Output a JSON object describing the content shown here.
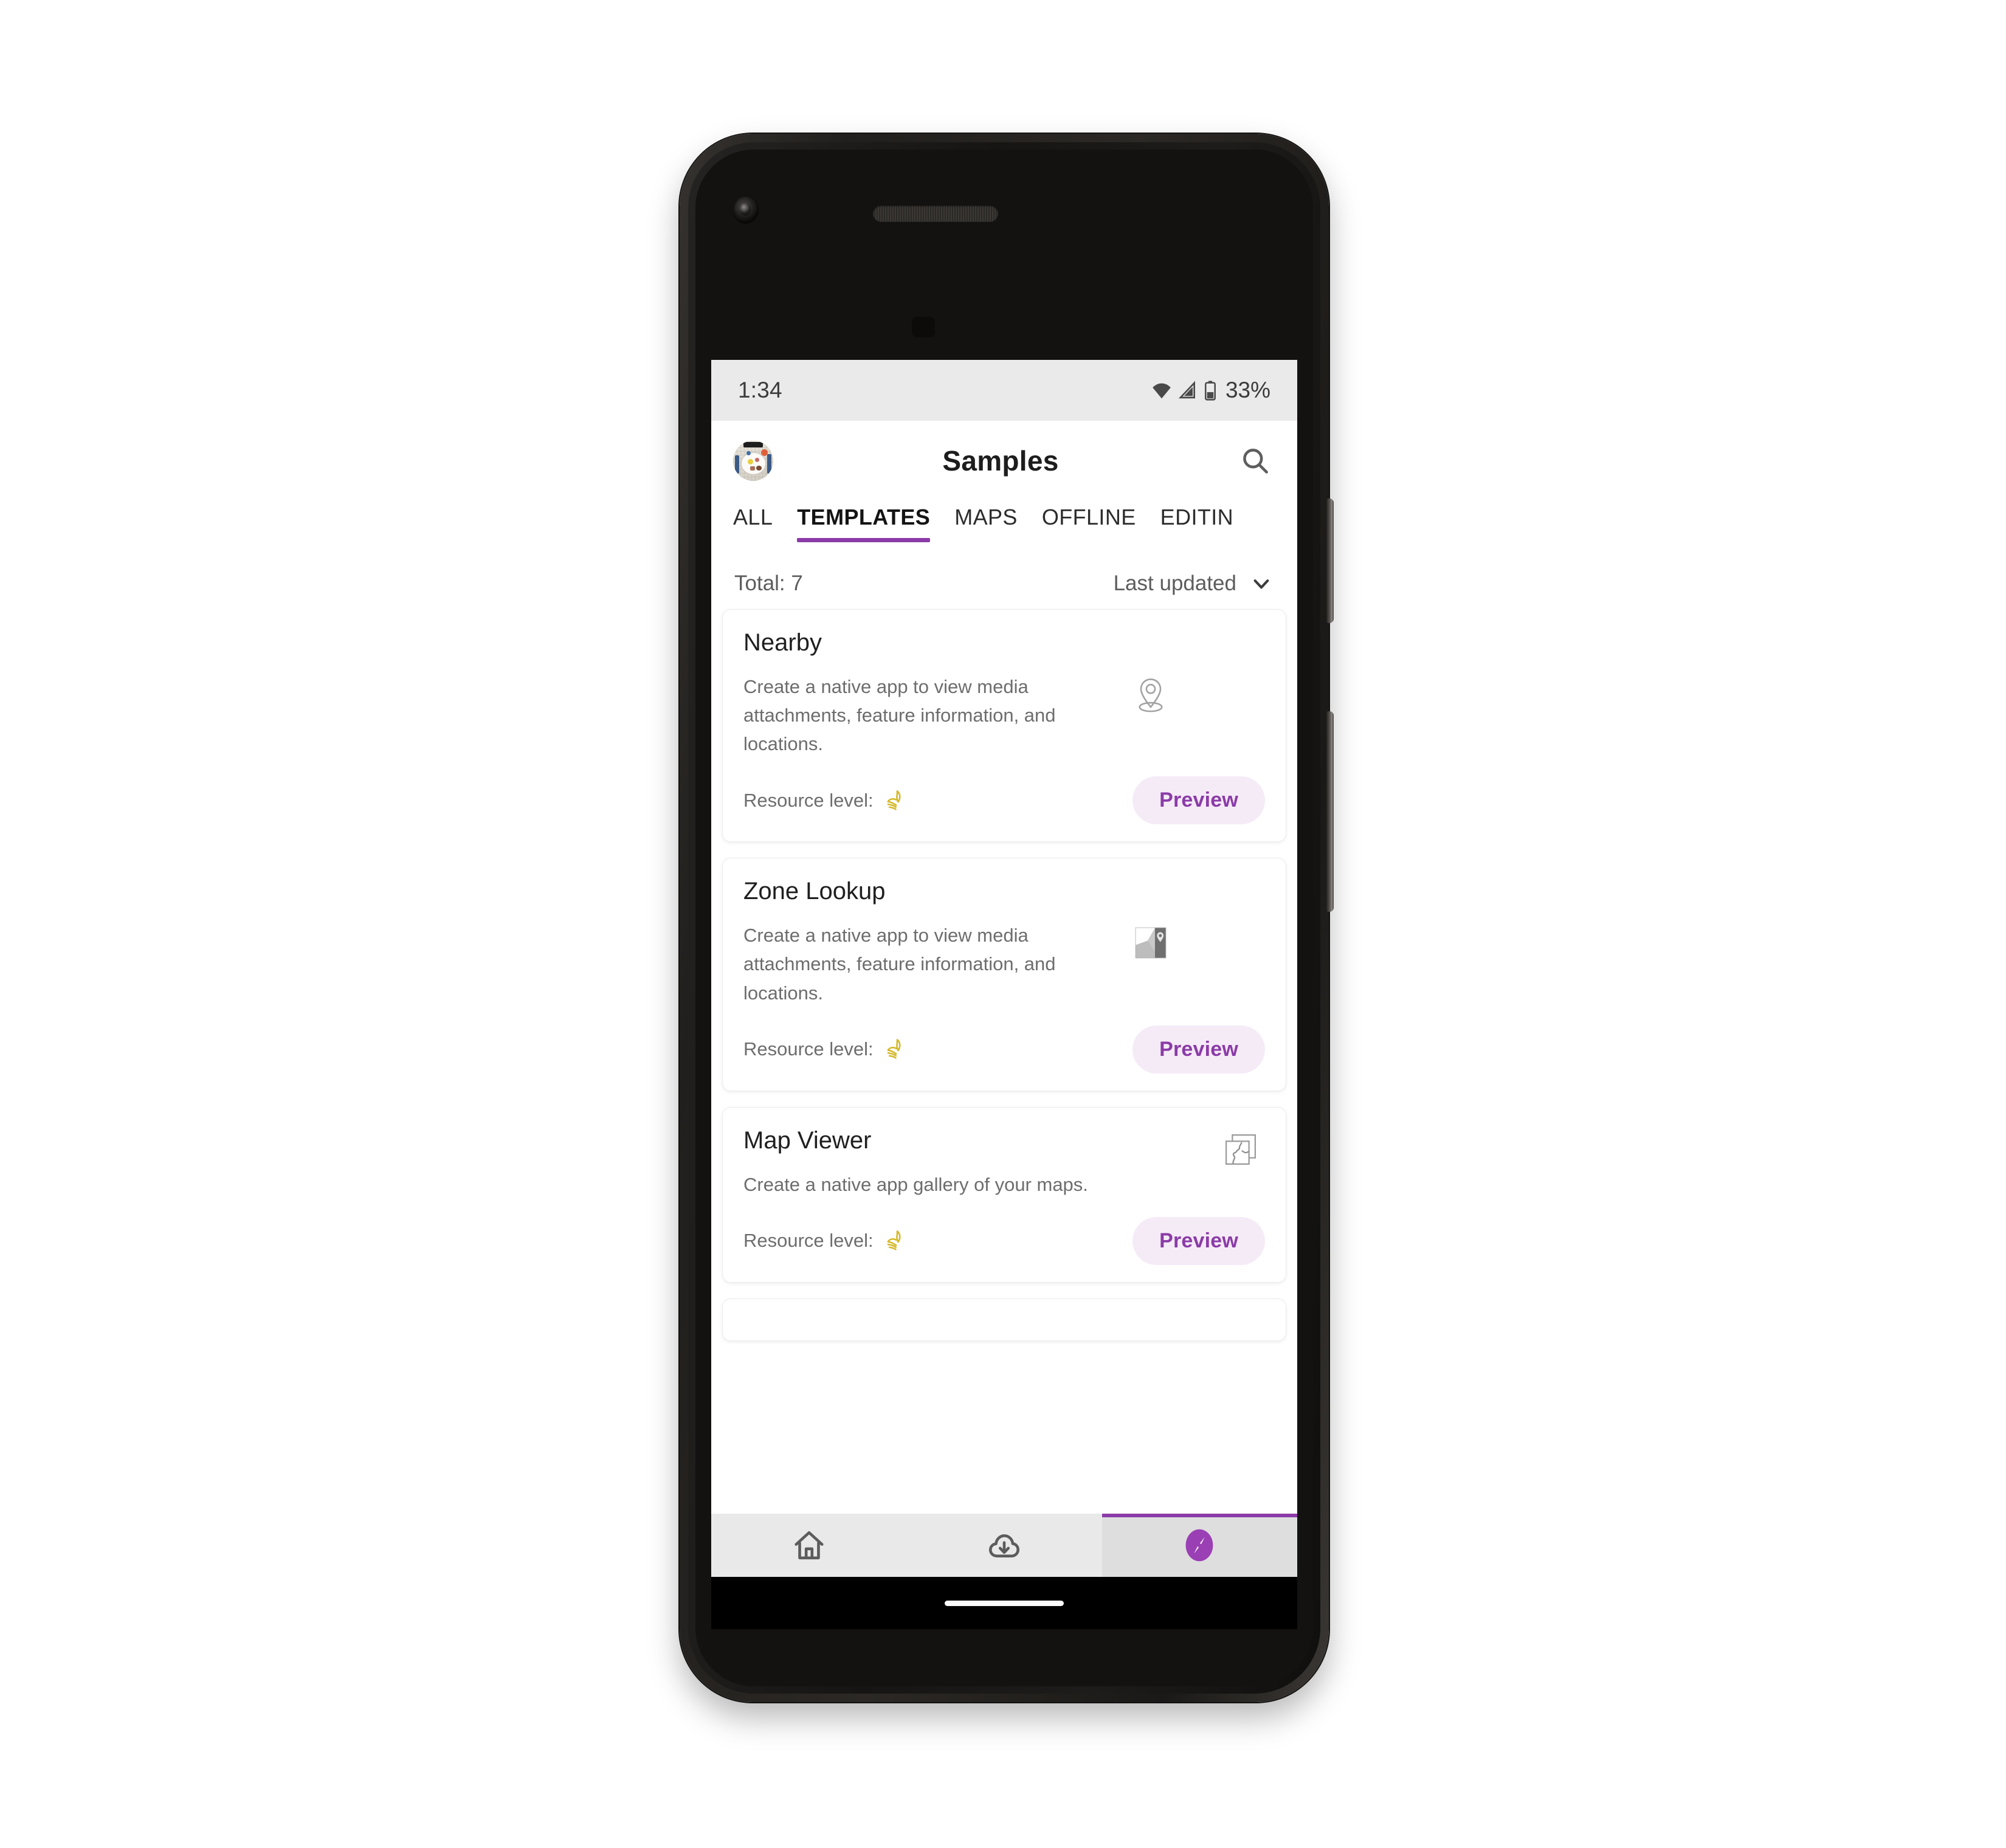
{
  "status_bar": {
    "time": "1:34",
    "battery_percent": "33%",
    "icons": [
      "wifi-icon",
      "cellular-signal-icon",
      "battery-icon"
    ]
  },
  "app_bar": {
    "title": "Samples",
    "avatar_name": "user-avatar",
    "search_icon": "search-icon"
  },
  "tabs": [
    {
      "label": "ALL",
      "active": false
    },
    {
      "label": "TEMPLATES",
      "active": true
    },
    {
      "label": "MAPS",
      "active": false
    },
    {
      "label": "OFFLINE",
      "active": false
    },
    {
      "label": "EDITIN",
      "active": false
    }
  ],
  "meta": {
    "total_label": "Total: 7",
    "sort_label": "Last updated",
    "sort_icon": "chevron-down-icon"
  },
  "cards": [
    {
      "title": "Nearby",
      "description": "Create a native app to view media attachments, feature information, and locations.",
      "resource_label": "Resource level:",
      "resource_icon": "leaf-hand-icon",
      "preview_label": "Preview",
      "thumb_icon": "location-pin-icon"
    },
    {
      "title": "Zone Lookup",
      "description": "Create a native app to view media attachments, feature information, and locations.",
      "resource_label": "Resource level:",
      "resource_icon": "leaf-hand-icon",
      "preview_label": "Preview",
      "thumb_icon": "map-thumbnail-icon"
    },
    {
      "title": "Map Viewer",
      "description": "Create a native app gallery of your maps.",
      "resource_label": "Resource level:",
      "resource_icon": "leaf-hand-icon",
      "preview_label": "Preview",
      "thumb_icon": "layered-maps-icon"
    }
  ],
  "bottom_nav": [
    {
      "name": "home",
      "icon": "home-icon",
      "active": false
    },
    {
      "name": "downloads",
      "icon": "cloud-download-icon",
      "active": false
    },
    {
      "name": "explore",
      "icon": "compass-icon",
      "active": true
    }
  ],
  "colors": {
    "accent_purple": "#8B3BA8",
    "preview_pill_bg": "#F5EBF7",
    "resource_yellow": "#D4B829",
    "status_bar_bg": "#EAEAEA",
    "nav_bar_bg": "#E9E9E9"
  }
}
